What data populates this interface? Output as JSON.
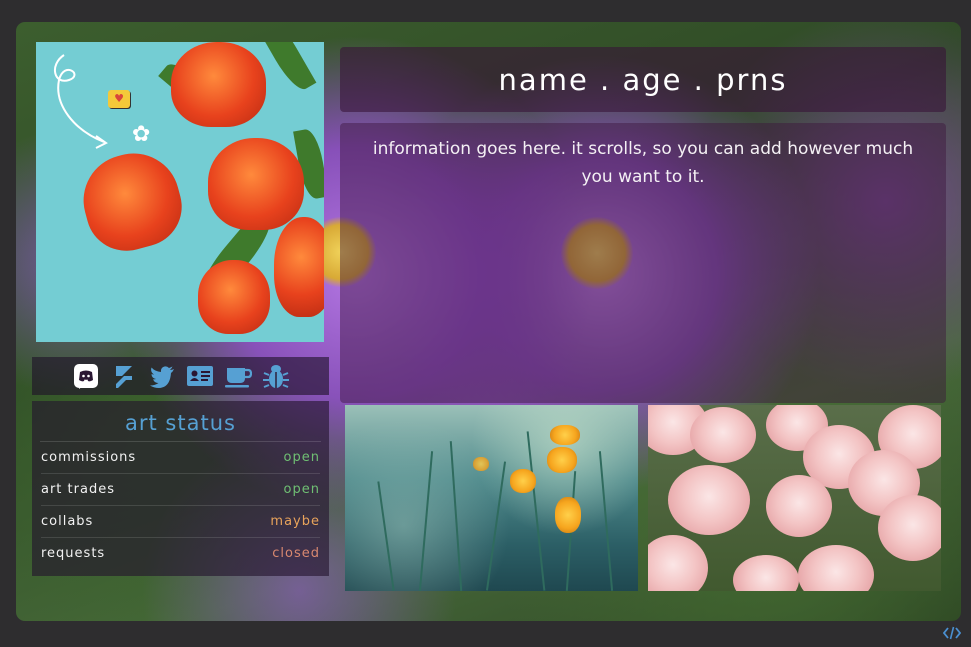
{
  "header": {
    "name_line": "name . age . prns"
  },
  "info": {
    "text": "information goes here. it scrolls, so you can add however much you want to it."
  },
  "social_icons": [
    {
      "name": "discord-icon",
      "color": "#ffffff"
    },
    {
      "name": "ko-fi-icon",
      "color": "#56a0d3"
    },
    {
      "name": "twitter-icon",
      "color": "#56a0d3"
    },
    {
      "name": "id-card-icon",
      "color": "#56a0d3"
    },
    {
      "name": "coffee-cup-icon",
      "color": "#56a0d3"
    },
    {
      "name": "bug-icon",
      "color": "#56a0d3"
    }
  ],
  "art_status": {
    "title": "art status",
    "rows": [
      {
        "label": "commissions",
        "value": "open",
        "color": "#6fbf73"
      },
      {
        "label": "art trades",
        "value": "open",
        "color": "#6fbf73"
      },
      {
        "label": "collabs",
        "value": "maybe",
        "color": "#e8a35b"
      },
      {
        "label": "requests",
        "value": "closed",
        "color": "#d98870"
      }
    ]
  },
  "colors": {
    "accent": "#56a0d3",
    "panel": "#2a1733"
  }
}
